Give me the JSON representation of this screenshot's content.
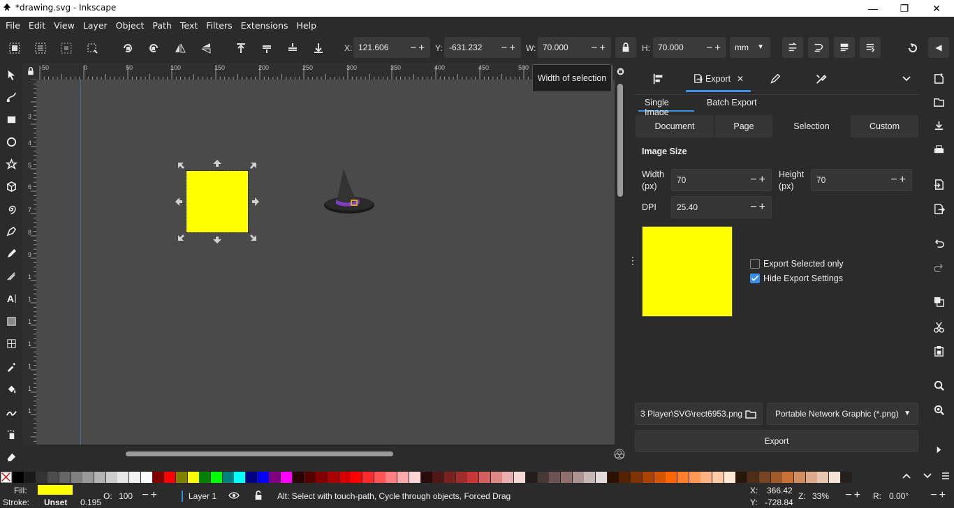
{
  "window": {
    "title": "*drawing.svg - Inkscape",
    "minimize": "—",
    "restore": "❐",
    "close": "✕"
  },
  "menu": [
    "File",
    "Edit",
    "View",
    "Layer",
    "Object",
    "Path",
    "Text",
    "Filters",
    "Extensions",
    "Help"
  ],
  "toolbar": {
    "x_label": "X:",
    "x_value": "121.606",
    "y_label": "Y:",
    "y_value": "-631.232",
    "w_label": "W:",
    "w_value": "70.000",
    "h_label": "H:",
    "h_value": "70.000",
    "unit": "mm",
    "pm": "−+"
  },
  "tooltip": "Width of selection",
  "ruler": {
    "h_ticks": [
      "-50",
      "0",
      "50",
      "100",
      "150",
      "200",
      "250",
      "300",
      "350",
      "400",
      "450",
      "500"
    ],
    "v_ticks": [
      "3",
      "4",
      "5",
      "6",
      "7",
      "8",
      "9",
      "1",
      "1",
      "1",
      "1",
      "1",
      "1",
      "1"
    ]
  },
  "dock": {
    "tab_label": "Export",
    "tab_close": "✕",
    "subtabs": [
      "Single Image",
      "Batch Export"
    ],
    "modes": [
      "Document",
      "Page",
      "Selection",
      "Custom"
    ],
    "active_mode": "Selection",
    "image_size_heading": "Image Size",
    "width_label": "Width\n(px)",
    "width_label_1": "Width",
    "width_label_2": "(px)",
    "width_value": "70",
    "height_label_1": "Height",
    "height_label_2": "(px)",
    "height_value": "70",
    "dpi_label": "DPI",
    "dpi_value": "25.40",
    "export_selected_only": "Export Selected only",
    "hide_export_settings": "Hide Export Settings",
    "export_selected_checked": false,
    "hide_export_checked": true,
    "filename": "3 Player\\SVG\\rect6953.png",
    "format": "Portable Network Graphic (*.png)",
    "export_button": "Export",
    "preview_color": "#ffff00"
  },
  "status": {
    "fill_label": "Fill:",
    "stroke_label": "Stroke:",
    "fill_color": "#ffff00",
    "stroke_value": "Unset",
    "stroke_width": "0.195",
    "opacity_label": "O:",
    "opacity_value": "100",
    "layer": "Layer 1",
    "message": "Alt: Select with touch-path, Cycle through objects, Forced Drag",
    "x_label": "X:",
    "x_value": "366.42",
    "y_label": "Y:",
    "y_value": "-728.84",
    "zoom_label": "Z:",
    "zoom_value": "33%",
    "rotate_label": "R:",
    "rotate_value": "0.00°"
  },
  "palette": [
    "#000000",
    "#1a1a1a",
    "#333333",
    "#4d4d4d",
    "#666666",
    "#808080",
    "#999999",
    "#b3b3b3",
    "#cccccc",
    "#e6e6e6",
    "#f2f2f2",
    "#ffffff",
    "#800000",
    "#ff0000",
    "#808000",
    "#ffff00",
    "#008000",
    "#00ff00",
    "#008080",
    "#00ffff",
    "#000080",
    "#0000ff",
    "#800080",
    "#ff00ff",
    "#2b0000",
    "#550000",
    "#800000",
    "#aa0000",
    "#d40000",
    "#ff0000",
    "#ff2a2a",
    "#ff5555",
    "#ff8080",
    "#ffaaaa",
    "#ffd5d5",
    "#280b0b",
    "#501616",
    "#782121",
    "#a02c2c",
    "#c83737",
    "#d35f5f",
    "#de8787",
    "#e9afaf",
    "#f4d7d7",
    "#241c1c",
    "#483737",
    "#6c5353",
    "#916f6f",
    "#ac9393",
    "#c8b7b7",
    "#e3dbdb",
    "#2b1100",
    "#552200",
    "#803300",
    "#aa4400",
    "#d45500",
    "#ff6600",
    "#ff7f2a",
    "#ff9955",
    "#ffb380",
    "#ffccaa",
    "#ffe6d5",
    "#28170b",
    "#502d16",
    "#784421",
    "#a05a2c",
    "#c87137",
    "#d38d5f",
    "#deaa87",
    "#e9c6af",
    "#f4e3d7",
    "#241f1c"
  ]
}
